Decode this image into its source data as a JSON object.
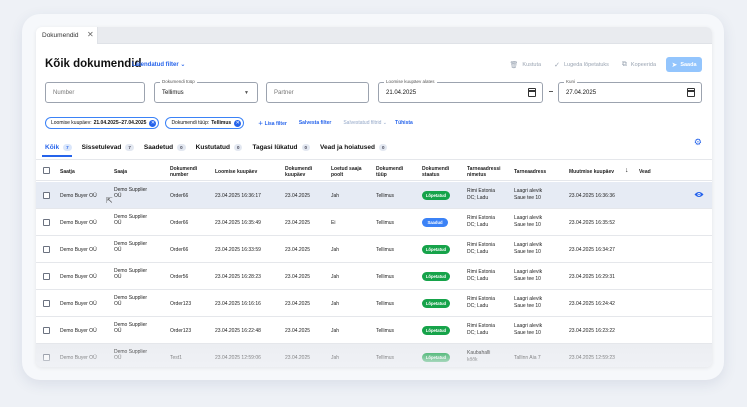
{
  "window_tab": {
    "label": "Dokumendid",
    "close": "✕"
  },
  "header": {
    "title": "Kõik dokumendid",
    "advanced_filter": "Laiendatud filter",
    "actions": {
      "delete": "Kustuta",
      "finish": "Lugeda lõpetatuks",
      "copy": "Kopeerida",
      "send": "Saada"
    }
  },
  "filters": {
    "number_placeholder": "Number",
    "doc_type_label": "Dokumendi tüüp",
    "doc_type_value": "Tellimus",
    "partner_placeholder": "Partner",
    "date_from_label": "Loomise kuupäev alates",
    "date_from_value": "21.04.2025",
    "date_to_label": "Kuni",
    "date_to_value": "27.04.2025"
  },
  "chips": [
    {
      "key": "Loomise kuupäev:",
      "value": "21.04.2025–27.04.2025"
    },
    {
      "key": "Dokumendi tüüp:",
      "value": "Tellimus"
    }
  ],
  "chip_actions": {
    "add": "Lisa filter",
    "save": "Salvesta filter",
    "saved": "Salvestatud filtrid",
    "cancel": "Tühista"
  },
  "status_tabs": [
    {
      "label": "Kõik",
      "count": "7"
    },
    {
      "label": "Sissetulevad",
      "count": "7"
    },
    {
      "label": "Saadetud",
      "count": "0"
    },
    {
      "label": "Kustutatud",
      "count": "0"
    },
    {
      "label": "Tagasi lükatud",
      "count": "0"
    },
    {
      "label": "Vead ja hoiatused",
      "count": "0"
    }
  ],
  "columns": {
    "sender": "Saatja",
    "receiver": "Saaja",
    "number": "Dokumendi number",
    "created": "Loomise kuupäev",
    "doc_date": "Dokumendi kuupäev",
    "read": "Loetud saaja poolt",
    "type": "Dokumendi tüüp",
    "status": "Dokumendi staatus",
    "delivery_name": "Tarneaadressi nimetus",
    "delivery_addr": "Tarneaadress",
    "modified": "Muutmise kuupäev",
    "errors": "Vead"
  },
  "rows": [
    {
      "sender": "Demo Buyer OÜ",
      "receiver": "Demo Supplier OÜ",
      "number": "Order66",
      "created": "23.04.2025 16:36:17",
      "doc_date": "23.04.2025",
      "read": "Jah",
      "type": "Tellimus",
      "status": "Lõpetatud",
      "status_color": "green",
      "dn1": "Rimi Estonia",
      "dn2": "DC; Ladu",
      "da1": "Laagri alevik",
      "da2": "Saue tee 10",
      "modified": "23.04.2025 16:36:36"
    },
    {
      "sender": "Demo Buyer OÜ",
      "receiver": "Demo Supplier OÜ",
      "number": "Order66",
      "created": "23.04.2025 16:35:49",
      "doc_date": "23.04.2025",
      "read": "Ei",
      "type": "Tellimus",
      "status": "Saadud",
      "status_color": "blue",
      "dn1": "Rimi Estonia",
      "dn2": "DC; Ladu",
      "da1": "Laagri alevik",
      "da2": "Saue tee 10",
      "modified": "23.04.2025 16:35:52"
    },
    {
      "sender": "Demo Buyer OÜ",
      "receiver": "Demo Supplier OÜ",
      "number": "Order66",
      "created": "23.04.2025 16:33:59",
      "doc_date": "23.04.2025",
      "read": "Jah",
      "type": "Tellimus",
      "status": "Lõpetatud",
      "status_color": "green",
      "dn1": "Rimi Estonia",
      "dn2": "DC; Ladu",
      "da1": "Laagri alevik",
      "da2": "Saue tee 10",
      "modified": "23.04.2025 16:34:27"
    },
    {
      "sender": "Demo Buyer OÜ",
      "receiver": "Demo Supplier OÜ",
      "number": "Order56",
      "created": "23.04.2025 16:28:23",
      "doc_date": "23.04.2025",
      "read": "Jah",
      "type": "Tellimus",
      "status": "Lõpetatud",
      "status_color": "green",
      "dn1": "Rimi Estonia",
      "dn2": "DC; Ladu",
      "da1": "Laagri alevik",
      "da2": "Saue tee 10",
      "modified": "23.04.2025 16:29:31"
    },
    {
      "sender": "Demo Buyer OÜ",
      "receiver": "Demo Supplier OÜ",
      "number": "Order123",
      "created": "23.04.2025 16:16:16",
      "doc_date": "23.04.2025",
      "read": "Jah",
      "type": "Tellimus",
      "status": "Lõpetatud",
      "status_color": "green",
      "dn1": "Rimi Estonia",
      "dn2": "DC; Ladu",
      "da1": "Laagri alevik",
      "da2": "Saue tee 10",
      "modified": "23.04.2025 16:24:42"
    },
    {
      "sender": "Demo Buyer OÜ",
      "receiver": "Demo Supplier OÜ",
      "number": "Order123",
      "created": "23.04.2025 16:22:48",
      "doc_date": "23.04.2025",
      "read": "Jah",
      "type": "Tellimus",
      "status": "Lõpetatud",
      "status_color": "green",
      "dn1": "Rimi Estonia",
      "dn2": "DC; Ladu",
      "da1": "Laagri alevik",
      "da2": "Saue tee 10",
      "modified": "23.04.2025 16:23:22"
    },
    {
      "sender": "Demo Buyer OÜ",
      "receiver": "Demo Supplier OÜ",
      "number": "Test1",
      "created": "23.04.2025 12:59:06",
      "doc_date": "23.04.2025",
      "read": "Jah",
      "type": "Tellimus",
      "status": "Lõpetatud",
      "status_color": "green",
      "dn1": "Kaubahalli",
      "dn2": "kõõk",
      "da1": "Tallinn Aia 7",
      "da2": "",
      "modified": "23.04.2025 12:59:23"
    }
  ],
  "icons": {
    "trash": "trash-icon",
    "check": "check-icon",
    "copy": "copy-icon",
    "send": "send-icon",
    "calendar": "calendar-icon",
    "gear": "gear-icon",
    "eye": "eye-icon",
    "sort": "arrow-down-icon"
  },
  "colors": {
    "accent": "#2563eb",
    "green": "#16a34a",
    "blue": "#3b82f6"
  }
}
